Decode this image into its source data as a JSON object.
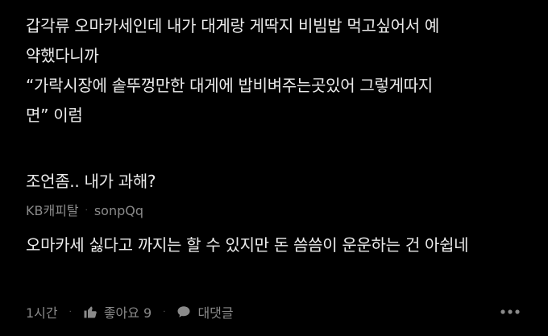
{
  "post": {
    "lines": [
      "갑각류 오마카세인데 내가 대게랑 게딱지 비빔밥 먹고싶어서 예",
      "약했다니까",
      "“가락시장에 솥뚜껑만한 대게에 밥비벼주는곳있어 그렇게따지",
      "면” 이럼"
    ],
    "question": "조언좀.. 내가 과해?"
  },
  "comment": {
    "author_company": "KB캐피탈",
    "separator": "·",
    "author_name": "sonpQq",
    "text": "오마카세 싫다고 까지는 할 수 있지만 돈 씀씀이 운운하는 건 아쉽네",
    "time": "1시간",
    "like_label": "좋아요 9",
    "reply_label": "대댓글"
  },
  "icons": {
    "like": "thumbs-up-icon",
    "reply": "speech-bubble-icon",
    "more": "more-dots-icon"
  },
  "colors": {
    "background": "#000000",
    "text": "#ececec",
    "muted": "#8a8a8a"
  }
}
